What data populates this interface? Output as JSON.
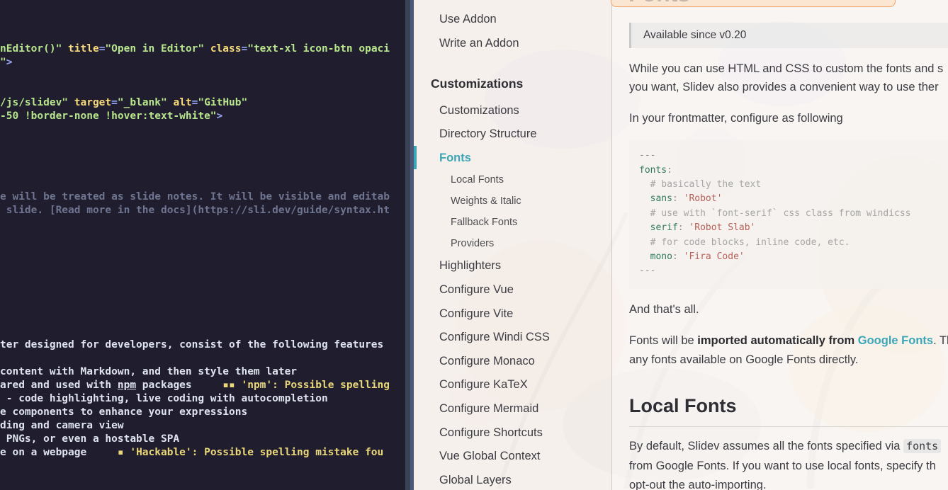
{
  "terminal": {
    "lines": [
      [
        {
          "t": "nEditor()\" ",
          "c": "g"
        },
        {
          "t": "title",
          "c": "y"
        },
        {
          "t": "=",
          "c": "p"
        },
        {
          "t": "\"Open in Editor\" ",
          "c": "g"
        },
        {
          "t": "class",
          "c": "y"
        },
        {
          "t": "=",
          "c": "p"
        },
        {
          "t": "\"text-xl icon-btn opaci",
          "c": "g"
        }
      ],
      [
        {
          "t": "\"",
          "c": "g"
        },
        {
          "t": ">",
          "c": "p"
        }
      ],
      [
        {
          "t": "/js/slidev\" ",
          "c": "g"
        },
        {
          "t": "target",
          "c": "y"
        },
        {
          "t": "=",
          "c": "p"
        },
        {
          "t": "\"_blank\" ",
          "c": "g"
        },
        {
          "t": "alt",
          "c": "y"
        },
        {
          "t": "=",
          "c": "p"
        },
        {
          "t": "\"GitHub\"",
          "c": "g"
        }
      ],
      [
        {
          "t": "-50 !border-none !hover:text-white\"",
          "c": "g"
        },
        {
          "t": ">",
          "c": "p"
        }
      ],
      [
        {
          "t": "e will be treated as slide notes. It will be visible and editab",
          "c": "c"
        }
      ],
      [
        {
          "t": " slide. [Read more in the docs](https://sli.dev/guide/syntax.ht",
          "c": "c"
        }
      ],
      [
        {
          "t": "ter designed for developers, consist of the following features",
          "c": "w"
        }
      ],
      [
        {
          "t": "content with Markdown, and then style them later",
          "c": "w"
        }
      ],
      [
        {
          "t": "ared and used with ",
          "c": "w"
        },
        {
          "t": "npm",
          "c": "w",
          "u": true
        },
        {
          "t": " packages     ",
          "c": "w"
        },
        {
          "t": "▪▪ 'npm': Possible spelling",
          "c": "diag"
        }
      ],
      [
        {
          "t": " - code highlighting, live coding with autocompletion",
          "c": "w"
        }
      ],
      [
        {
          "t": "e components to enhance your expressions",
          "c": "w"
        }
      ],
      [
        {
          "t": "ding and camera view",
          "c": "w"
        }
      ],
      [
        {
          "t": " PNGs, or even a hostable SPA",
          "c": "w"
        }
      ],
      [
        {
          "t": "e on a webpage     ",
          "c": "w"
        },
        {
          "t": "▪ 'Hackable': Possible spelling mistake fou",
          "c": "diag"
        }
      ]
    ]
  },
  "sidebar": {
    "top_items": [
      "Use Addon",
      "Write an Addon"
    ],
    "section_title": "Customizations",
    "items": [
      "Customizations",
      "Directory Structure",
      "Fonts"
    ],
    "sub_items": [
      "Local Fonts",
      "Weights & Italic",
      "Fallback Fonts",
      "Providers"
    ],
    "more_items": [
      "Highlighters",
      "Configure Vue",
      "Configure Vite",
      "Configure Windi CSS",
      "Configure Monaco",
      "Configure KaTeX",
      "Configure Mermaid",
      "Configure Shortcuts",
      "Vue Global Context",
      "Global Layers"
    ]
  },
  "content": {
    "page_title": "Fonts",
    "available_since": "Available since v0.20",
    "intro_line1": "While you can use HTML and CSS to custom the fonts and s",
    "intro_line2": "you want, Slidev also provides a convenient way to use ther",
    "configure_text": "In your frontmatter, configure as following",
    "code_lines": [
      [
        {
          "t": "---",
          "c": "pu"
        }
      ],
      [
        {
          "t": "fonts",
          "c": "k"
        },
        {
          "t": ":",
          "c": "pu"
        }
      ],
      [
        {
          "t": "  # basically the text",
          "c": "cm"
        }
      ],
      [
        {
          "t": "  sans",
          "c": "k"
        },
        {
          "t": ": ",
          "c": "pu"
        },
        {
          "t": "'Robot'",
          "c": "s"
        }
      ],
      [
        {
          "t": "  # use with `font-serif` css class from windicss",
          "c": "cm"
        }
      ],
      [
        {
          "t": "  serif",
          "c": "k"
        },
        {
          "t": ": ",
          "c": "pu"
        },
        {
          "t": "'Robot Slab'",
          "c": "s"
        }
      ],
      [
        {
          "t": "  # for code blocks, inline code, etc.",
          "c": "cm"
        }
      ],
      [
        {
          "t": "  mono",
          "c": "k"
        },
        {
          "t": ": ",
          "c": "pu"
        },
        {
          "t": "'Fira Code'",
          "c": "s"
        }
      ],
      [
        {
          "t": "---",
          "c": "pu"
        }
      ]
    ],
    "thats_all": "And that's all.",
    "fonts_will_be": "Fonts will be ",
    "imported_bold": "imported automatically from",
    "google_fonts_link": "Google Fonts",
    "fonts_tail": ". Th",
    "any_fonts_line": "any fonts available on Google Fonts directly.",
    "local_fonts_heading": "Local Fonts",
    "default_text": "By default, Slidev assumes all the fonts specified via ",
    "fonts_code": "fonts",
    "from_google_line": "from Google Fonts. If you want to use local fonts, specify th",
    "opt_out_line": "opt-out the auto-importing."
  }
}
